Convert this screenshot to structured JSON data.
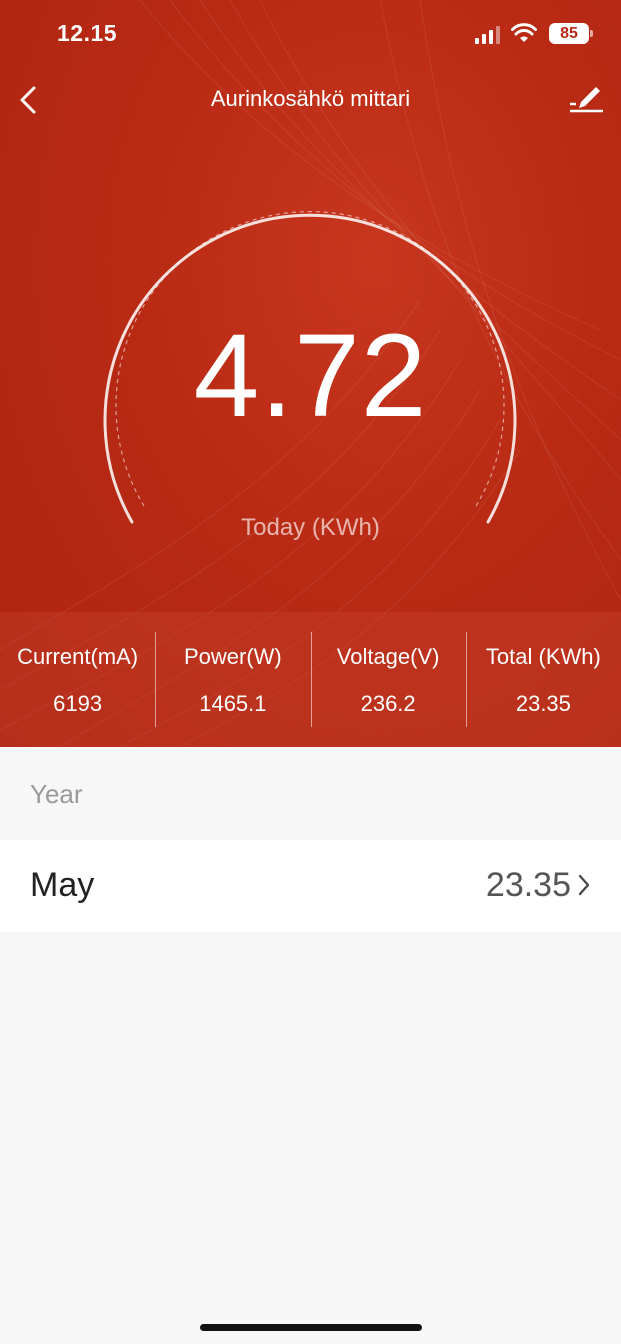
{
  "status_bar": {
    "time": "12.15",
    "battery": "85",
    "icons": [
      "signal-icon",
      "wifi-icon",
      "battery-icon"
    ]
  },
  "nav": {
    "title": "Aurinkosähkö mittari",
    "back_icon": "chevron-left-icon",
    "edit_icon": "edit-pencil-icon"
  },
  "gauge": {
    "value": "4.72",
    "label": "Today (KWh)"
  },
  "metrics": [
    {
      "label": "Current(mA)",
      "value": "6193"
    },
    {
      "label": "Power(W)",
      "value": "1465.1"
    },
    {
      "label": "Voltage(V)",
      "value": "236.2"
    },
    {
      "label": "Total (KWh)",
      "value": "23.35"
    }
  ],
  "history": {
    "section_label": "Year",
    "rows": [
      {
        "month": "May",
        "value": "23.35"
      }
    ]
  },
  "colors": {
    "accent": "#b92a14",
    "background": "#f7f7f7"
  }
}
